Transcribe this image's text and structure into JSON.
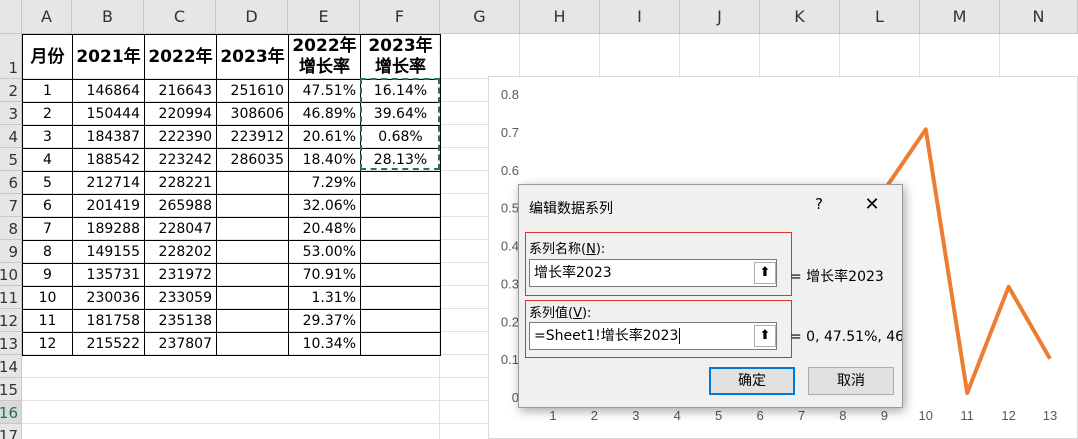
{
  "sheet": {
    "columns": [
      "A",
      "B",
      "C",
      "D",
      "E",
      "F",
      "G",
      "H",
      "I",
      "J",
      "K",
      "L",
      "M",
      "N"
    ],
    "rows": [
      "1",
      "2",
      "3",
      "4",
      "5",
      "6",
      "7",
      "8",
      "9",
      "10",
      "11",
      "12",
      "13",
      "14",
      "15",
      "16",
      "17"
    ],
    "selected_row": "16"
  },
  "table": {
    "headers": [
      "月份",
      "2021年",
      "2022年",
      "2023年",
      "2022年\n增长率",
      "2023年\n增长率"
    ],
    "rows": [
      [
        "1",
        "146864",
        "216643",
        "251610",
        "47.51%",
        "16.14%"
      ],
      [
        "2",
        "150444",
        "220994",
        "308606",
        "46.89%",
        "39.64%"
      ],
      [
        "3",
        "184387",
        "222390",
        "223912",
        "20.61%",
        "0.68%"
      ],
      [
        "4",
        "188542",
        "223242",
        "286035",
        "18.40%",
        "28.13%"
      ],
      [
        "5",
        "212714",
        "228221",
        "",
        "7.29%",
        ""
      ],
      [
        "6",
        "201419",
        "265988",
        "",
        "32.06%",
        ""
      ],
      [
        "7",
        "189288",
        "228047",
        "",
        "20.48%",
        ""
      ],
      [
        "8",
        "149155",
        "228202",
        "",
        "53.00%",
        ""
      ],
      [
        "9",
        "135731",
        "231972",
        "",
        "70.91%",
        ""
      ],
      [
        "10",
        "230036",
        "233059",
        "",
        "1.31%",
        ""
      ],
      [
        "11",
        "181758",
        "235138",
        "",
        "29.37%",
        ""
      ],
      [
        "12",
        "215522",
        "237807",
        "",
        "10.34%",
        ""
      ]
    ]
  },
  "chart_data": {
    "type": "line",
    "x": [
      1,
      2,
      3,
      4,
      5,
      6,
      7,
      8,
      9,
      10,
      11,
      12,
      13
    ],
    "series": [
      {
        "values": [
          null,
          null,
          null,
          null,
          null,
          null,
          null,
          null,
          0.5491,
          0.7091,
          0.0131,
          0.2937,
          0.1034
        ],
        "color": "#ed7d31"
      }
    ],
    "y_ticks": [
      "0",
      "0.1",
      "0.2",
      "0.3",
      "0.4",
      "0.5",
      "0.6",
      "0.7",
      "0.8"
    ],
    "x_ticks": [
      "1",
      "2",
      "3",
      "4",
      "5",
      "6",
      "7",
      "8",
      "9",
      "10",
      "11",
      "12",
      "13"
    ],
    "ylim": [
      0,
      0.8
    ],
    "xlim": [
      1,
      13
    ],
    "grid": false,
    "legend": "none"
  },
  "dialog": {
    "title": "编辑数据系列",
    "help": "?",
    "close": "✕",
    "name_label": "系列名称(",
    "name_key": "N",
    "name_label_end": "):",
    "name_value": "增长率2023",
    "name_preview": "= 增长率2023",
    "values_label": "系列值(",
    "values_key": "V",
    "values_label_end": "):",
    "values_value": "=Sheet1!增长率2023",
    "values_preview": "= 0, 47.51%, 46.",
    "ok": "确定",
    "cancel": "取消",
    "collapse_icon": "⬆"
  },
  "colors": {
    "accent": "#0078d7",
    "highlight_border": "#e03030",
    "series_line": "#ed7d31",
    "copy_marquee": "#1e7a46"
  }
}
